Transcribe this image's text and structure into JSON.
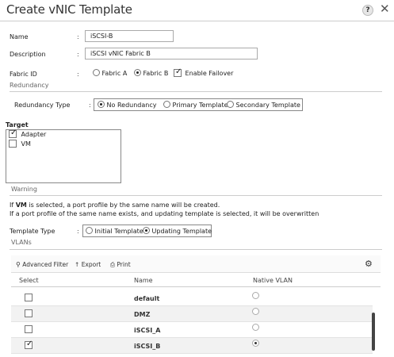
{
  "dialog": {
    "title": "Create vNIC Template",
    "help_label": "?",
    "close_label": "✕"
  },
  "form": {
    "name_label": "Name",
    "name_value": "iSCSI-B",
    "description_label": "Description",
    "description_value": "iSCSI vNIC Fabric B",
    "fabric_label": "Fabric ID",
    "fabric_options": [
      "Fabric A",
      "Fabric B"
    ],
    "fabric_selected": "Fabric B",
    "failover_label": "Enable Failover",
    "failover_checked": true,
    "colon": ":"
  },
  "redundancy": {
    "section_title": "Redundancy",
    "type_label": "Redundancy Type",
    "options": [
      "No Redundancy",
      "Primary Template",
      "Secondary Template"
    ],
    "selected": "No Redundancy"
  },
  "target": {
    "section_title": "Target",
    "items": [
      {
        "label": "Adapter",
        "checked": true
      },
      {
        "label": "VM",
        "checked": false
      }
    ]
  },
  "warning": {
    "section_title": "Warning",
    "line1_prefix": "If ",
    "line1_bold": "VM",
    "line1_suffix": " is selected, a port profile by the same name will be created.",
    "line2": "If a port profile of the same name exists, and updating template is selected, it will be overwritten"
  },
  "template_type": {
    "label": "Template Type",
    "options": [
      "Initial Template",
      "Updating Template"
    ],
    "selected": "Updating Template"
  },
  "vlans": {
    "section_title": "VLANs",
    "toolbar": {
      "filter_label": "Advanced Filter",
      "export_label": "Export",
      "print_label": "Print"
    },
    "columns": [
      "Select",
      "Name",
      "Native VLAN"
    ],
    "rows": [
      {
        "name": "default",
        "selected": false,
        "native": false
      },
      {
        "name": "DMZ",
        "selected": false,
        "native": false
      },
      {
        "name": "iSCSI_A",
        "selected": false,
        "native": false
      },
      {
        "name": "iSCSI_B",
        "selected": true,
        "native": true
      }
    ]
  },
  "colors": {
    "text": "#222222",
    "section_gray": "#666666",
    "row_alt": "#f2f2f2",
    "scrollbar": "#444444"
  }
}
